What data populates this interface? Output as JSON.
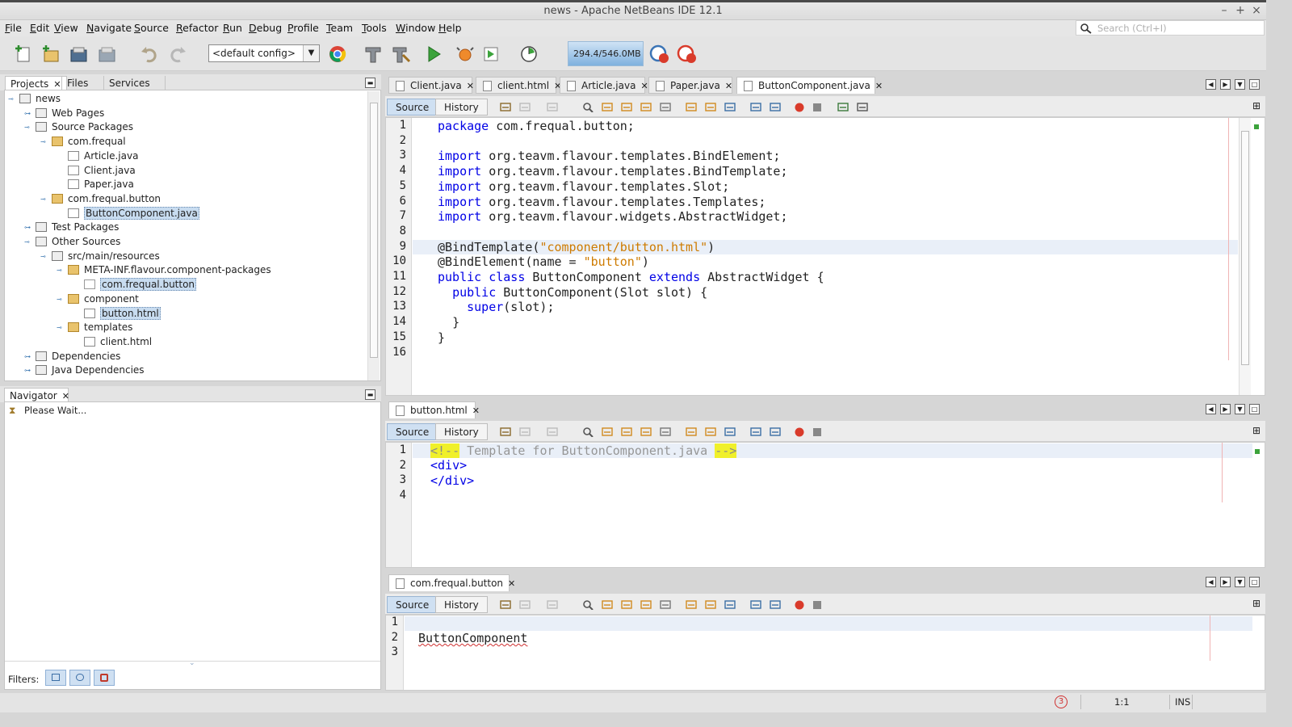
{
  "window": {
    "title": "news - Apache NetBeans IDE 12.1",
    "controls": [
      "–",
      "+",
      "×"
    ]
  },
  "menu": [
    "File",
    "Edit",
    "View",
    "Navigate",
    "Source",
    "Refactor",
    "Run",
    "Debug",
    "Profile",
    "Team",
    "Tools",
    "Window",
    "Help"
  ],
  "search": {
    "placeholder": "Search (Ctrl+I)"
  },
  "toolbar": {
    "config": "<default config>",
    "memory": "294.4/546.0MB"
  },
  "projects_panel": {
    "tabs": [
      "Projects",
      "Files",
      "Services"
    ],
    "tree": [
      {
        "label": "news",
        "level": 0,
        "icon": "project-icon"
      },
      {
        "label": "Web Pages",
        "level": 1,
        "icon": "folder-icon"
      },
      {
        "label": "Source Packages",
        "level": 1,
        "icon": "folder-icon"
      },
      {
        "label": "com.frequal",
        "level": 2,
        "icon": "package-icon"
      },
      {
        "label": "Article.java",
        "level": 3,
        "icon": "java-file-icon"
      },
      {
        "label": "Client.java",
        "level": 3,
        "icon": "java-file-icon"
      },
      {
        "label": "Paper.java",
        "level": 3,
        "icon": "java-file-icon"
      },
      {
        "label": "com.frequal.button",
        "level": 2,
        "icon": "package-icon"
      },
      {
        "label": "ButtonComponent.java",
        "level": 3,
        "icon": "java-file-icon",
        "selected": true
      },
      {
        "label": "Test Packages",
        "level": 1,
        "icon": "folder-icon"
      },
      {
        "label": "Other Sources",
        "level": 1,
        "icon": "folder-icon"
      },
      {
        "label": "src/main/resources",
        "level": 2,
        "icon": "folder-icon"
      },
      {
        "label": "META-INF.flavour.component-packages",
        "level": 3,
        "icon": "package-icon"
      },
      {
        "label": "com.frequal.button",
        "level": 4,
        "icon": "file-icon",
        "selected": true
      },
      {
        "label": "component",
        "level": 3,
        "icon": "package-icon"
      },
      {
        "label": "button.html",
        "level": 4,
        "icon": "html-file-icon",
        "selected": true
      },
      {
        "label": "templates",
        "level": 3,
        "icon": "package-icon"
      },
      {
        "label": "client.html",
        "level": 4,
        "icon": "html-file-icon"
      },
      {
        "label": "Dependencies",
        "level": 1,
        "icon": "folder-icon"
      },
      {
        "label": "Java Dependencies",
        "level": 1,
        "icon": "folder-icon"
      }
    ]
  },
  "navigator": {
    "tab": "Navigator",
    "status": "Please Wait...",
    "filters_label": "Filters:"
  },
  "editor1": {
    "tabs": [
      "Client.java",
      "client.html",
      "Article.java",
      "Paper.java",
      "ButtonComponent.java"
    ],
    "active_tab": "ButtonComponent.java",
    "source_label": "Source",
    "history_label": "History",
    "line_numbers": [
      "1",
      "2",
      "3",
      "4",
      "5",
      "6",
      "7",
      "8",
      "9",
      "10",
      "11",
      "12",
      "13",
      "14",
      "15",
      "16"
    ],
    "lines": [
      {
        "indent": "",
        "kw": "package",
        "rest": " com.frequal.button;"
      },
      {
        "indent": "",
        "kw": "",
        "rest": ""
      },
      {
        "indent": "",
        "kw": "import",
        "rest": " org.teavm.flavour.templates.BindElement;"
      },
      {
        "indent": "",
        "kw": "import",
        "rest": " org.teavm.flavour.templates.BindTemplate;"
      },
      {
        "indent": "",
        "kw": "import",
        "rest": " org.teavm.flavour.templates.Slot;"
      },
      {
        "indent": "",
        "kw": "import",
        "rest": " org.teavm.flavour.templates.Templates;"
      },
      {
        "indent": "",
        "kw": "import",
        "rest": " org.teavm.flavour.widgets.AbstractWidget;"
      },
      {
        "indent": "",
        "kw": "",
        "rest": ""
      },
      {
        "indent": "",
        "kw": "",
        "rest": "@BindTemplate(",
        "str": "\"component/button.html\"",
        "tail": ")"
      },
      {
        "indent": "",
        "kw": "",
        "rest": "@BindElement(name = ",
        "str": "\"button\"",
        "tail": ")"
      },
      {
        "indent": "",
        "kw": "public class",
        "rest": " ButtonComponent ",
        "kw2": "extends",
        "tail": " AbstractWidget {"
      },
      {
        "indent": "  ",
        "kw": "public",
        "rest": " ButtonComponent(Slot slot) {"
      },
      {
        "indent": "    ",
        "kw": "super",
        "rest": "(slot);"
      },
      {
        "indent": "  ",
        "kw": "",
        "rest": "}"
      },
      {
        "indent": "",
        "kw": "",
        "rest": "}"
      },
      {
        "indent": "",
        "kw": "",
        "rest": ""
      }
    ]
  },
  "editor2": {
    "tab": "button.html",
    "source_label": "Source",
    "history_label": "History",
    "line_numbers": [
      "1",
      "2",
      "3",
      "4"
    ],
    "comment_open": "<!--",
    "comment_text": " Template for ButtonComponent.java ",
    "comment_close": "-->",
    "line2": "<div>",
    "line3": "</div>"
  },
  "editor3": {
    "tab": "com.frequal.button",
    "source_label": "Source",
    "history_label": "History",
    "line_numbers": [
      "1",
      "2",
      "3"
    ],
    "line2": "ButtonComponent"
  },
  "status": {
    "badge": "3",
    "position": "1:1",
    "mode": "INS"
  }
}
